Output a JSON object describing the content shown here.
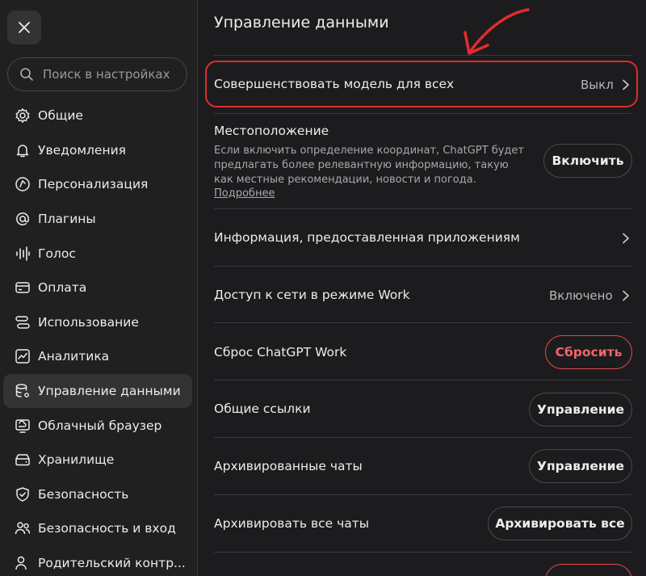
{
  "sidebar": {
    "search_placeholder": "Поиск в настройках",
    "items": [
      {
        "label": "Общие",
        "icon": "gear-icon"
      },
      {
        "label": "Уведомления",
        "icon": "bell-icon"
      },
      {
        "label": "Персонализация",
        "icon": "personalization-icon"
      },
      {
        "label": "Плагины",
        "icon": "plugins-icon"
      },
      {
        "label": "Голос",
        "icon": "voice-waveform-icon"
      },
      {
        "label": "Оплата",
        "icon": "credit-card-icon"
      },
      {
        "label": "Использование",
        "icon": "usage-icon"
      },
      {
        "label": "Аналитика",
        "icon": "analytics-chart-icon"
      },
      {
        "label": "Управление данными",
        "icon": "database-gear-icon",
        "active": true
      },
      {
        "label": "Облачный браузер",
        "icon": "cloud-browser-icon"
      },
      {
        "label": "Хранилище",
        "icon": "storage-icon"
      },
      {
        "label": "Безопасность",
        "icon": "shield-icon"
      },
      {
        "label": "Безопасность и вход",
        "icon": "people-icon"
      },
      {
        "label": "Родительский контр...",
        "icon": "parent-user-icon"
      }
    ]
  },
  "main": {
    "title": "Управление данными",
    "improve_model": {
      "label": "Совершенствовать модель для всех",
      "value": "Выкл"
    },
    "location": {
      "label": "Местоположение",
      "description_lines": [
        "Если включить определение координат, ChatGPT будет",
        "предлагать более релевантную информацию, такую",
        "как местные рекомендации, новости и погода."
      ],
      "link": "Подробнее",
      "button": "Включить"
    },
    "app_info": {
      "label": "Информация, предоставленная приложениям"
    },
    "network_access": {
      "label": "Доступ к сети в режиме Work",
      "value": "Включено"
    },
    "reset": {
      "label": "Сброс ChatGPT Work",
      "button": "Сбросить"
    },
    "shared_links": {
      "label": "Общие ссылки",
      "button": "Управление"
    },
    "archived_chats": {
      "label": "Архивированные чаты",
      "button": "Управление"
    },
    "archive_all": {
      "label": "Архивировать все чаты",
      "button": "Архивировать все"
    }
  },
  "colors": {
    "background": "#1c1c1e",
    "sidebar": "#202021",
    "danger": "#f4636b",
    "highlight": "#e32b2b"
  }
}
